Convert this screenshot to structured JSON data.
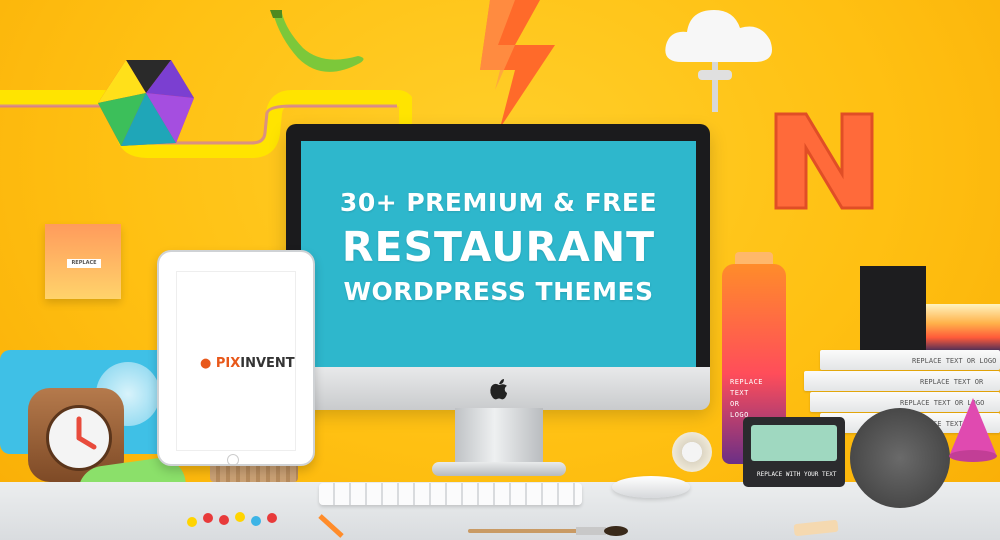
{
  "headline": {
    "line1": "30+ PREMIUM & FREE",
    "line2": "RESTAURANT",
    "line3": "WORDPRESS THEMES"
  },
  "tablet": {
    "logo_left": "PIX",
    "logo_right": "INVENT"
  },
  "props": {
    "note_label": "REPLACE",
    "bottle_text": [
      "REPLACE",
      "TEXT",
      "OR",
      "LOGO"
    ],
    "book_text": [
      "REPLACE TEXT OR LOGO",
      "REPLACE TEXT OR",
      "REPLACE TEXT OR LOGO",
      "REPLACE TEXT OR"
    ],
    "cassette_text": "REPLACE WITH YOUR TEXT"
  },
  "colors": {
    "background": "#ffc012",
    "screen": "#2eb7cc",
    "logo_accent": "#e8581a"
  }
}
